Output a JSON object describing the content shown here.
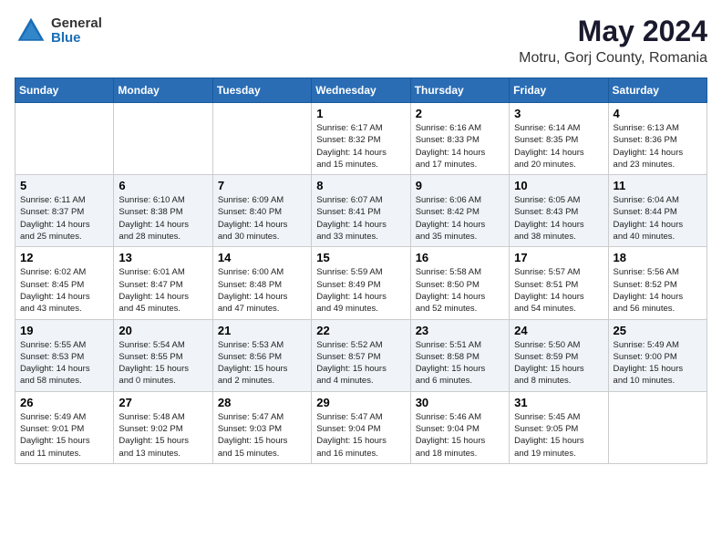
{
  "logo": {
    "general": "General",
    "blue": "Blue"
  },
  "title": "May 2024",
  "subtitle": "Motru, Gorj County, Romania",
  "weekdays": [
    "Sunday",
    "Monday",
    "Tuesday",
    "Wednesday",
    "Thursday",
    "Friday",
    "Saturday"
  ],
  "weeks": [
    [
      {
        "day": "",
        "info": ""
      },
      {
        "day": "",
        "info": ""
      },
      {
        "day": "",
        "info": ""
      },
      {
        "day": "1",
        "info": "Sunrise: 6:17 AM\nSunset: 8:32 PM\nDaylight: 14 hours\nand 15 minutes."
      },
      {
        "day": "2",
        "info": "Sunrise: 6:16 AM\nSunset: 8:33 PM\nDaylight: 14 hours\nand 17 minutes."
      },
      {
        "day": "3",
        "info": "Sunrise: 6:14 AM\nSunset: 8:35 PM\nDaylight: 14 hours\nand 20 minutes."
      },
      {
        "day": "4",
        "info": "Sunrise: 6:13 AM\nSunset: 8:36 PM\nDaylight: 14 hours\nand 23 minutes."
      }
    ],
    [
      {
        "day": "5",
        "info": "Sunrise: 6:11 AM\nSunset: 8:37 PM\nDaylight: 14 hours\nand 25 minutes."
      },
      {
        "day": "6",
        "info": "Sunrise: 6:10 AM\nSunset: 8:38 PM\nDaylight: 14 hours\nand 28 minutes."
      },
      {
        "day": "7",
        "info": "Sunrise: 6:09 AM\nSunset: 8:40 PM\nDaylight: 14 hours\nand 30 minutes."
      },
      {
        "day": "8",
        "info": "Sunrise: 6:07 AM\nSunset: 8:41 PM\nDaylight: 14 hours\nand 33 minutes."
      },
      {
        "day": "9",
        "info": "Sunrise: 6:06 AM\nSunset: 8:42 PM\nDaylight: 14 hours\nand 35 minutes."
      },
      {
        "day": "10",
        "info": "Sunrise: 6:05 AM\nSunset: 8:43 PM\nDaylight: 14 hours\nand 38 minutes."
      },
      {
        "day": "11",
        "info": "Sunrise: 6:04 AM\nSunset: 8:44 PM\nDaylight: 14 hours\nand 40 minutes."
      }
    ],
    [
      {
        "day": "12",
        "info": "Sunrise: 6:02 AM\nSunset: 8:45 PM\nDaylight: 14 hours\nand 43 minutes."
      },
      {
        "day": "13",
        "info": "Sunrise: 6:01 AM\nSunset: 8:47 PM\nDaylight: 14 hours\nand 45 minutes."
      },
      {
        "day": "14",
        "info": "Sunrise: 6:00 AM\nSunset: 8:48 PM\nDaylight: 14 hours\nand 47 minutes."
      },
      {
        "day": "15",
        "info": "Sunrise: 5:59 AM\nSunset: 8:49 PM\nDaylight: 14 hours\nand 49 minutes."
      },
      {
        "day": "16",
        "info": "Sunrise: 5:58 AM\nSunset: 8:50 PM\nDaylight: 14 hours\nand 52 minutes."
      },
      {
        "day": "17",
        "info": "Sunrise: 5:57 AM\nSunset: 8:51 PM\nDaylight: 14 hours\nand 54 minutes."
      },
      {
        "day": "18",
        "info": "Sunrise: 5:56 AM\nSunset: 8:52 PM\nDaylight: 14 hours\nand 56 minutes."
      }
    ],
    [
      {
        "day": "19",
        "info": "Sunrise: 5:55 AM\nSunset: 8:53 PM\nDaylight: 14 hours\nand 58 minutes."
      },
      {
        "day": "20",
        "info": "Sunrise: 5:54 AM\nSunset: 8:55 PM\nDaylight: 15 hours\nand 0 minutes."
      },
      {
        "day": "21",
        "info": "Sunrise: 5:53 AM\nSunset: 8:56 PM\nDaylight: 15 hours\nand 2 minutes."
      },
      {
        "day": "22",
        "info": "Sunrise: 5:52 AM\nSunset: 8:57 PM\nDaylight: 15 hours\nand 4 minutes."
      },
      {
        "day": "23",
        "info": "Sunrise: 5:51 AM\nSunset: 8:58 PM\nDaylight: 15 hours\nand 6 minutes."
      },
      {
        "day": "24",
        "info": "Sunrise: 5:50 AM\nSunset: 8:59 PM\nDaylight: 15 hours\nand 8 minutes."
      },
      {
        "day": "25",
        "info": "Sunrise: 5:49 AM\nSunset: 9:00 PM\nDaylight: 15 hours\nand 10 minutes."
      }
    ],
    [
      {
        "day": "26",
        "info": "Sunrise: 5:49 AM\nSunset: 9:01 PM\nDaylight: 15 hours\nand 11 minutes."
      },
      {
        "day": "27",
        "info": "Sunrise: 5:48 AM\nSunset: 9:02 PM\nDaylight: 15 hours\nand 13 minutes."
      },
      {
        "day": "28",
        "info": "Sunrise: 5:47 AM\nSunset: 9:03 PM\nDaylight: 15 hours\nand 15 minutes."
      },
      {
        "day": "29",
        "info": "Sunrise: 5:47 AM\nSunset: 9:04 PM\nDaylight: 15 hours\nand 16 minutes."
      },
      {
        "day": "30",
        "info": "Sunrise: 5:46 AM\nSunset: 9:04 PM\nDaylight: 15 hours\nand 18 minutes."
      },
      {
        "day": "31",
        "info": "Sunrise: 5:45 AM\nSunset: 9:05 PM\nDaylight: 15 hours\nand 19 minutes."
      },
      {
        "day": "",
        "info": ""
      }
    ]
  ]
}
